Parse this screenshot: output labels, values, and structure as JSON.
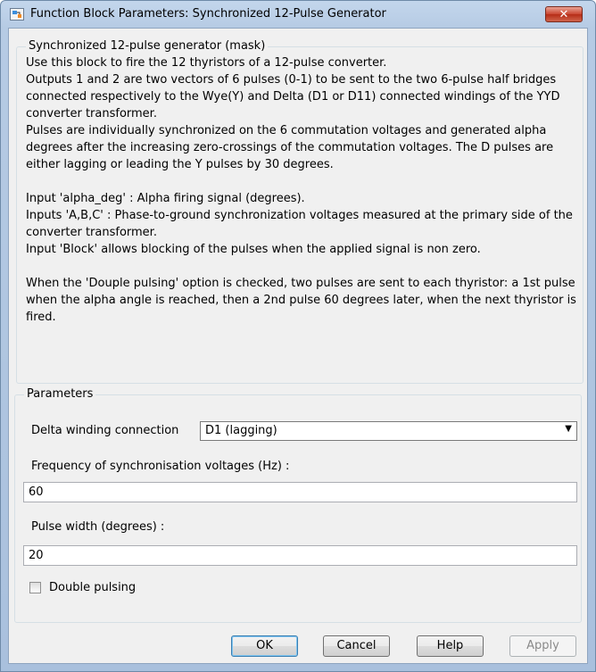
{
  "window": {
    "title": "Function Block Parameters: Synchronized 12-Pulse Generator",
    "close_label": "✕"
  },
  "mask": {
    "group_title": "Synchronized 12-pulse generator (mask)",
    "paragraphs": [
      "Use this block to fire the 12 thyristors of a 12-pulse converter.\nOutputs 1 and 2 are two vectors of 6 pulses (0-1) to be sent to the two 6-pulse half bridges connected respectively to the Wye(Y) and Delta (D1 or D11) connected windings of the YYD converter transformer.\nPulses are individually synchronized on the 6 commutation voltages and generated alpha degrees after the increasing zero-crossings of the commutation voltages. The D pulses are either lagging or leading the Y pulses by 30 degrees.",
      "Input 'alpha_deg' :  Alpha firing signal (degrees).\nInputs 'A,B,C' : Phase-to-ground synchronization voltages  measured at the  primary side of the converter transformer.\nInput 'Block' allows  blocking of the pulses when the applied signal is non zero.",
      "When the 'Douple pulsing' option is checked, two pulses are sent to each thyristor: a 1st pulse when the alpha angle is reached, then a 2nd pulse 60 degrees later, when the next thyristor is fired."
    ]
  },
  "parameters": {
    "group_title": "Parameters",
    "delta_label": "Delta winding connection",
    "delta_value": "D1 (lagging)",
    "freq_label": "Frequency of synchronisation voltages (Hz) :",
    "freq_value": "60",
    "pulse_label": "Pulse width (degrees) :",
    "pulse_value": "20",
    "double_label": "Double pulsing"
  },
  "buttons": {
    "ok": "OK",
    "cancel": "Cancel",
    "help": "Help",
    "apply": "Apply"
  }
}
